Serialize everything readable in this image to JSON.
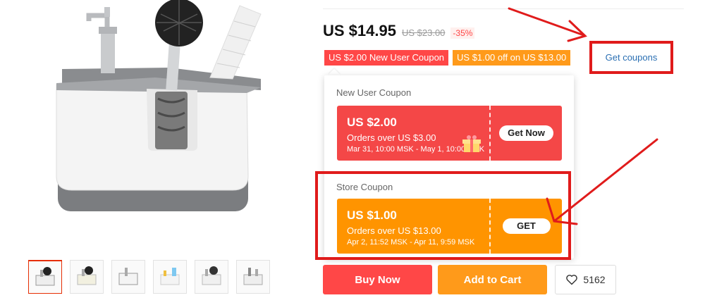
{
  "product": {
    "thumbnails": [
      {
        "name": "thumb-1",
        "active": true
      },
      {
        "name": "thumb-2"
      },
      {
        "name": "thumb-3"
      },
      {
        "name": "thumb-4"
      },
      {
        "name": "thumb-5"
      },
      {
        "name": "thumb-6"
      }
    ]
  },
  "price": {
    "current": "US $14.95",
    "original": "US $23.00",
    "discount": "-35%"
  },
  "coupon_tags": {
    "new_user": "US $2.00 New User Coupon",
    "store": "US $1.00 off on US $13.00",
    "get_coupons": "Get coupons"
  },
  "popup": {
    "new_user": {
      "title": "New User Coupon",
      "amount": "US $2.00",
      "condition": "Orders over US $3.00",
      "date": "Mar 31, 10:00 MSK - May 1, 10:00 MSK",
      "button": "Get Now"
    },
    "store": {
      "title": "Store Coupon",
      "amount": "US $1.00",
      "condition": "Orders over US $13.00",
      "date": "Apr 2, 11:52 MSK - Apr 11, 9:59 MSK",
      "button": "GET"
    }
  },
  "actions": {
    "buy_now": "Buy Now",
    "add_to_cart": "Add to Cart",
    "wishlist_count": "5162"
  },
  "colors": {
    "red": "#ff4747",
    "orange": "#ff9a1a",
    "link": "#2a6fb3",
    "annotation": "#e01b1b"
  },
  "icons": [
    "heart-icon",
    "gift-icon"
  ]
}
